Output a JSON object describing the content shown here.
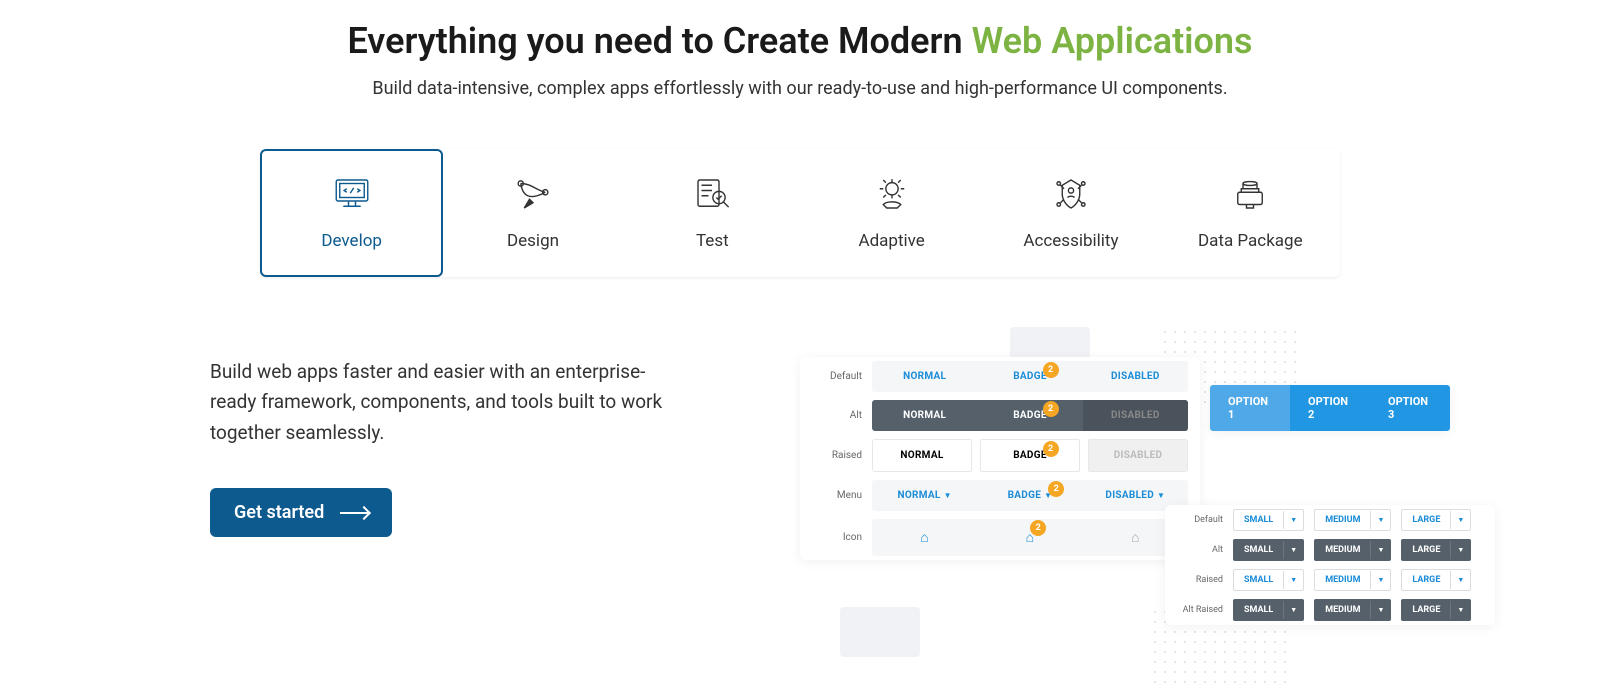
{
  "heading": {
    "main": "Everything you need to Create Modern ",
    "accent": "Web Applications"
  },
  "subheading": "Build data-intensive, complex apps effortlessly with our ready-to-use and high-performance UI components.",
  "tabs": [
    {
      "label": "Develop",
      "active": true
    },
    {
      "label": "Design"
    },
    {
      "label": "Test"
    },
    {
      "label": "Adaptive"
    },
    {
      "label": "Accessibility"
    },
    {
      "label": "Data Package"
    }
  ],
  "description": "Build web apps faster and easier with an enterprise-ready framework, components, and tools built to work together seamlessly.",
  "cta": "Get started",
  "table1": {
    "rows": [
      {
        "label": "Default",
        "cells": [
          "NORMAL",
          "BADGE",
          "DISABLED"
        ],
        "badge": "2",
        "variant": "light"
      },
      {
        "label": "Alt",
        "cells": [
          "NORMAL",
          "BADGE",
          "DISABLED"
        ],
        "badge": "2",
        "variant": "dark"
      },
      {
        "label": "Raised",
        "cells": [
          "NORMAL",
          "BADGE",
          "DISABLED"
        ],
        "badge": "2",
        "variant": "raised"
      },
      {
        "label": "Menu",
        "cells": [
          "NORMAL",
          "BADGE",
          "DISABLED"
        ],
        "badge": "2",
        "variant": "light",
        "caret": true
      },
      {
        "label": "Icon",
        "cells": [
          "home",
          "home",
          "home"
        ],
        "badge": "2",
        "variant": "icons"
      }
    ]
  },
  "options": [
    "OPTION 1",
    "OPTION 2",
    "OPTION 3"
  ],
  "table2": {
    "rows": [
      {
        "label": "Default",
        "cells": [
          "SMALL",
          "MEDIUM",
          "LARGE"
        ],
        "variant": "light"
      },
      {
        "label": "Alt",
        "cells": [
          "SMALL",
          "MEDIUM",
          "LARGE"
        ],
        "variant": "dark"
      },
      {
        "label": "Raised",
        "cells": [
          "SMALL",
          "MEDIUM",
          "LARGE"
        ],
        "variant": "light"
      },
      {
        "label": "Alt Raised",
        "cells": [
          "SMALL",
          "MEDIUM",
          "LARGE"
        ],
        "variant": "dark"
      }
    ]
  }
}
